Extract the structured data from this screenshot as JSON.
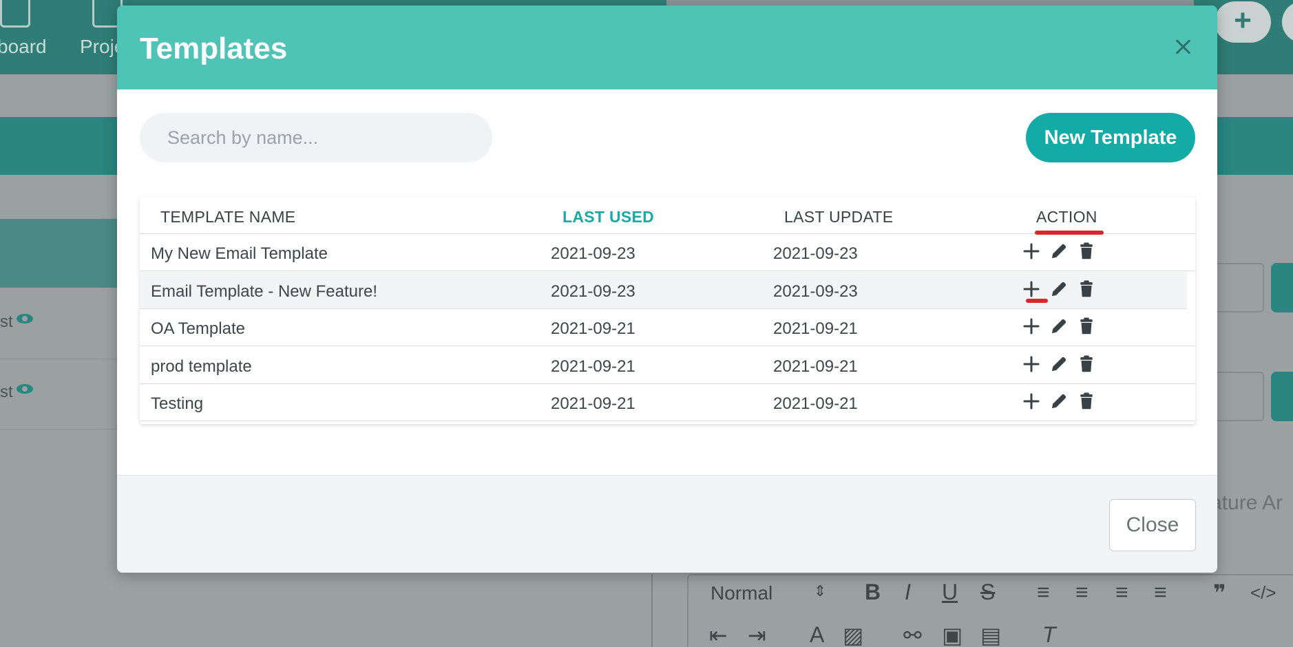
{
  "background": {
    "nav": [
      "board",
      "Proje"
    ],
    "left_rows": [
      "st",
      "st"
    ],
    "feature_text": "ature Ar",
    "editor": {
      "format_select": "Normal"
    }
  },
  "modal": {
    "title": "Templates",
    "search": {
      "placeholder": "Search by name...",
      "value": ""
    },
    "new_button_label": "New Template",
    "table": {
      "columns": [
        "TEMPLATE NAME",
        "LAST USED",
        "LAST UPDATE",
        "ACTION"
      ],
      "active_column": "LAST USED",
      "rows": [
        {
          "name": "My New Email Template",
          "last_used": "2021-09-23",
          "last_update": "2021-09-23"
        },
        {
          "name": "Email Template - New Feature!",
          "last_used": "2021-09-23",
          "last_update": "2021-09-23"
        },
        {
          "name": "OA Template",
          "last_used": "2021-09-21",
          "last_update": "2021-09-21"
        },
        {
          "name": "prod template",
          "last_used": "2021-09-21",
          "last_update": "2021-09-21"
        },
        {
          "name": "Testing",
          "last_used": "2021-09-21",
          "last_update": "2021-09-21"
        }
      ],
      "row_actions": [
        "plus-icon",
        "pencil-icon",
        "trash-icon"
      ]
    },
    "close_button_label": "Close"
  },
  "colors": {
    "header": "#4fc3b6",
    "accent": "#14aaa6",
    "annotation": "#d9262c"
  }
}
